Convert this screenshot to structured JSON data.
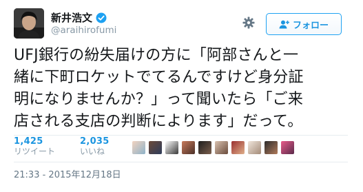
{
  "user": {
    "display_name": "新井浩文",
    "handle": "@araihirofumi"
  },
  "follow_button": {
    "label": "フォロー",
    "icon": "add-user-icon"
  },
  "icons": {
    "verified": "verified-badge-icon",
    "more": "gear-icon"
  },
  "colors": {
    "accent": "#1da1f2",
    "link": "#1b95e0",
    "muted": "#8899a6"
  },
  "tweet": {
    "lines": [
      "UFJ銀行の紛失届けの方に「阿部さんと一",
      "緒に下町ロケットでてるんですけど身分証",
      "明になりませんか？」って聞いたら「ご来",
      "店される支店の判断によります」だって。"
    ]
  },
  "stats": {
    "retweets": {
      "count": "1,425",
      "label": "リツイート"
    },
    "likes": {
      "count": "2,035",
      "label": "いいね"
    }
  },
  "timestamp": "21:33 - 2015年12月18日"
}
